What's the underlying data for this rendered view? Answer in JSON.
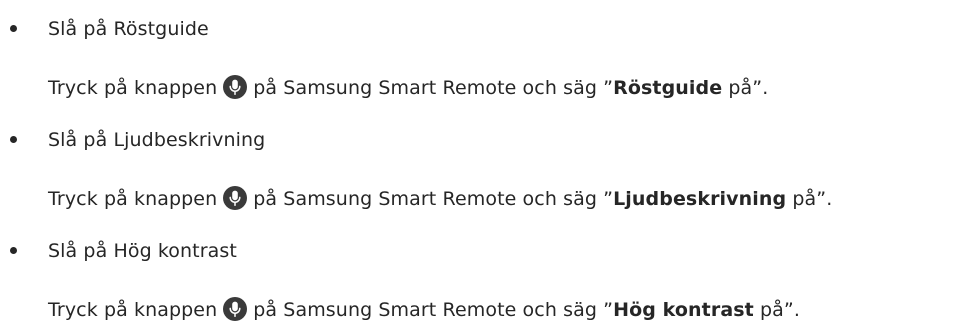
{
  "items": [
    {
      "title": "Slå på Röstguide",
      "desc_before": "Tryck på knappen",
      "desc_after": "på Samsung Smart Remote och säg ”",
      "command": "Röstguide",
      "desc_end": " på”.",
      "icon": "microphone-icon"
    },
    {
      "title": "Slå på Ljudbeskrivning",
      "desc_before": "Tryck på knappen",
      "desc_after": "på Samsung Smart Remote och säg ”",
      "command": "Ljudbeskrivning",
      "desc_end": " på”.",
      "icon": "microphone-icon"
    },
    {
      "title": "Slå på Hög kontrast",
      "desc_before": "Tryck på knappen",
      "desc_after": "på Samsung Smart Remote och säg ”",
      "command": "Hög kontrast",
      "desc_end": " på”.",
      "icon": "microphone-icon"
    }
  ],
  "colors": {
    "text": "#262626",
    "icon_bg": "#3a3a3a",
    "icon_fg": "#ffffff"
  }
}
